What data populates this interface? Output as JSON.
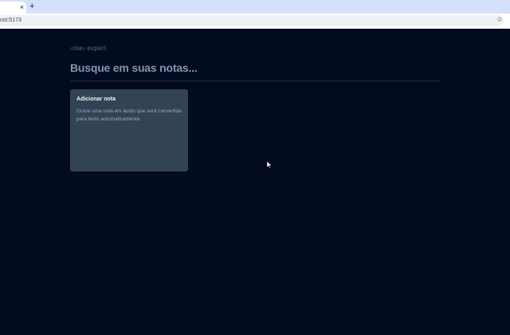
{
  "browser": {
    "tab_close": "×",
    "new_tab": "+",
    "address": "ost:5173",
    "bookmark_icon": "star-icon"
  },
  "app": {
    "logo": "‹nlw› expert",
    "search_placeholder": "Busque em suas notas...",
    "add_note_card": {
      "title": "Adicionar nota",
      "description": "Grave uma nota em áudio que será convertida para texto automaticamente."
    }
  },
  "colors": {
    "background": "#020b20",
    "card": "#334356",
    "divider": "#1e2b42"
  }
}
